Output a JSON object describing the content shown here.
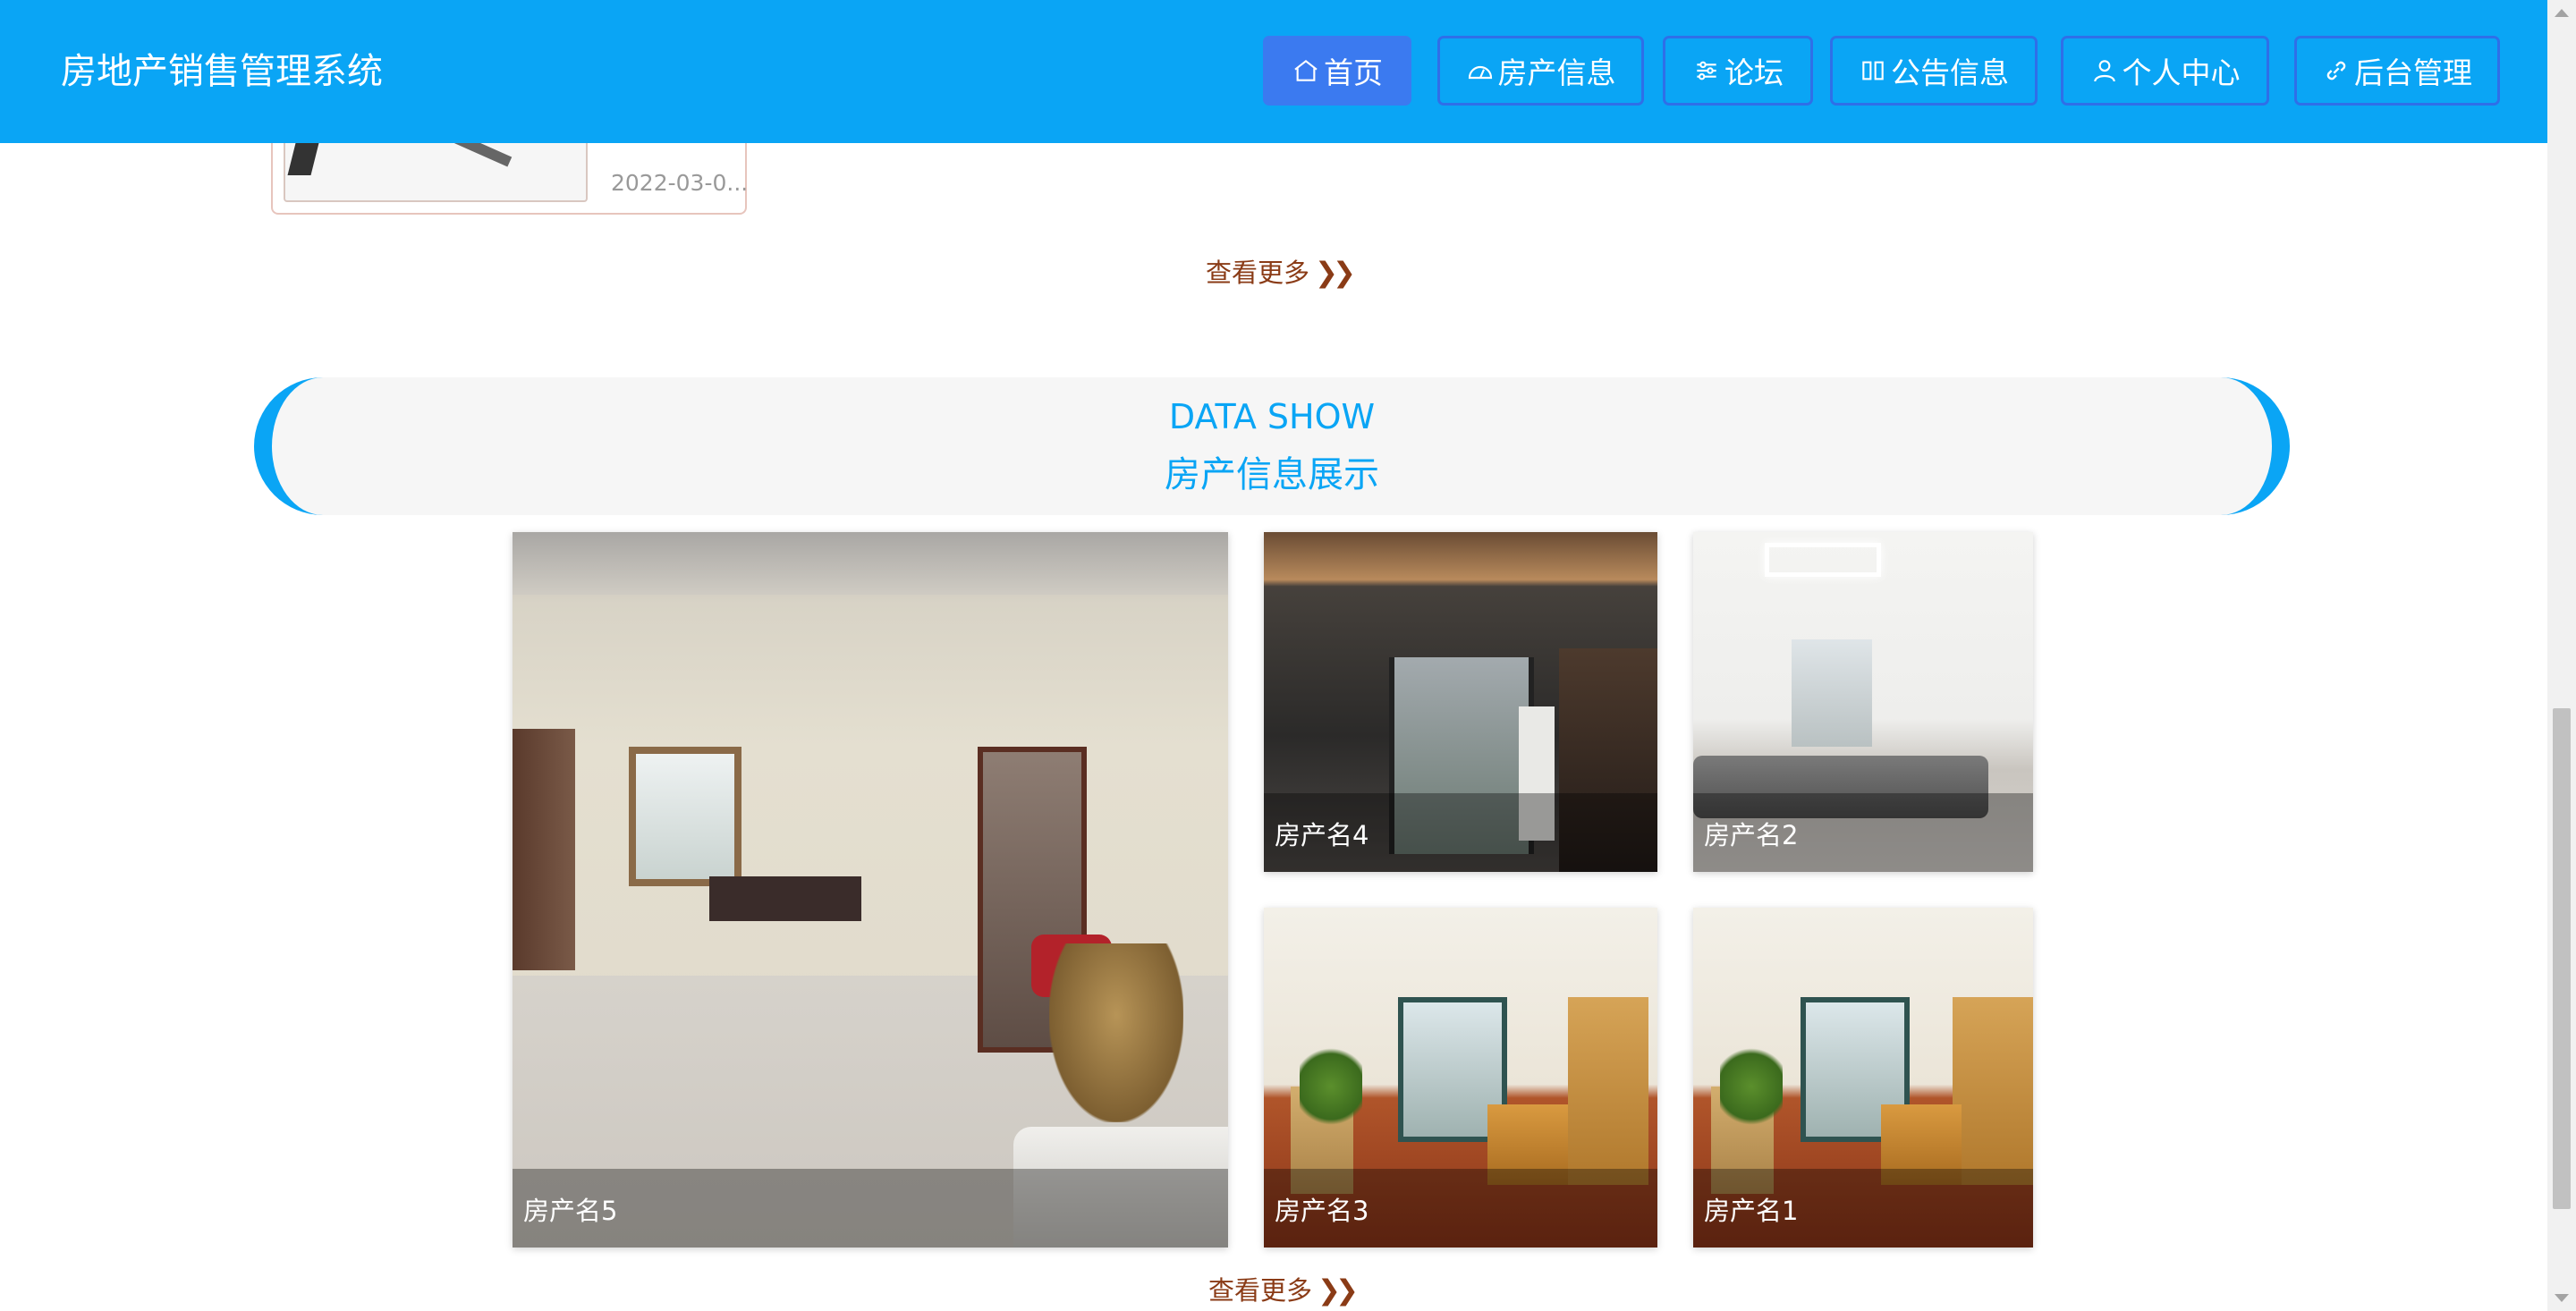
{
  "header": {
    "title": "房地产销售管理系统",
    "nav": [
      {
        "label": "首页",
        "icon": "home-icon",
        "active": true
      },
      {
        "label": "房产信息",
        "icon": "dashboard-icon",
        "active": false
      },
      {
        "label": "论坛",
        "icon": "sliders-icon",
        "active": false
      },
      {
        "label": "公告信息",
        "icon": "columns-icon",
        "active": false
      },
      {
        "label": "个人中心",
        "icon": "user-icon",
        "active": false
      },
      {
        "label": "后台管理",
        "icon": "link-icon",
        "active": false
      }
    ]
  },
  "prev_section": {
    "card_date": "2022-03-0...",
    "more_label": "查看更多"
  },
  "house_section": {
    "title_en": "DATA SHOW",
    "title_cn": "房产信息展示",
    "houses": [
      {
        "name": "房产名5"
      },
      {
        "name": "房产名4"
      },
      {
        "name": "房产名2"
      },
      {
        "name": "房产名3"
      },
      {
        "name": "房产名1"
      }
    ],
    "more_label": "查看更多"
  },
  "colors": {
    "primary": "#0aa5f5",
    "nav_border": "#2f6fe8",
    "active_nav": "#3b7af0",
    "link": "#8a3b16"
  }
}
